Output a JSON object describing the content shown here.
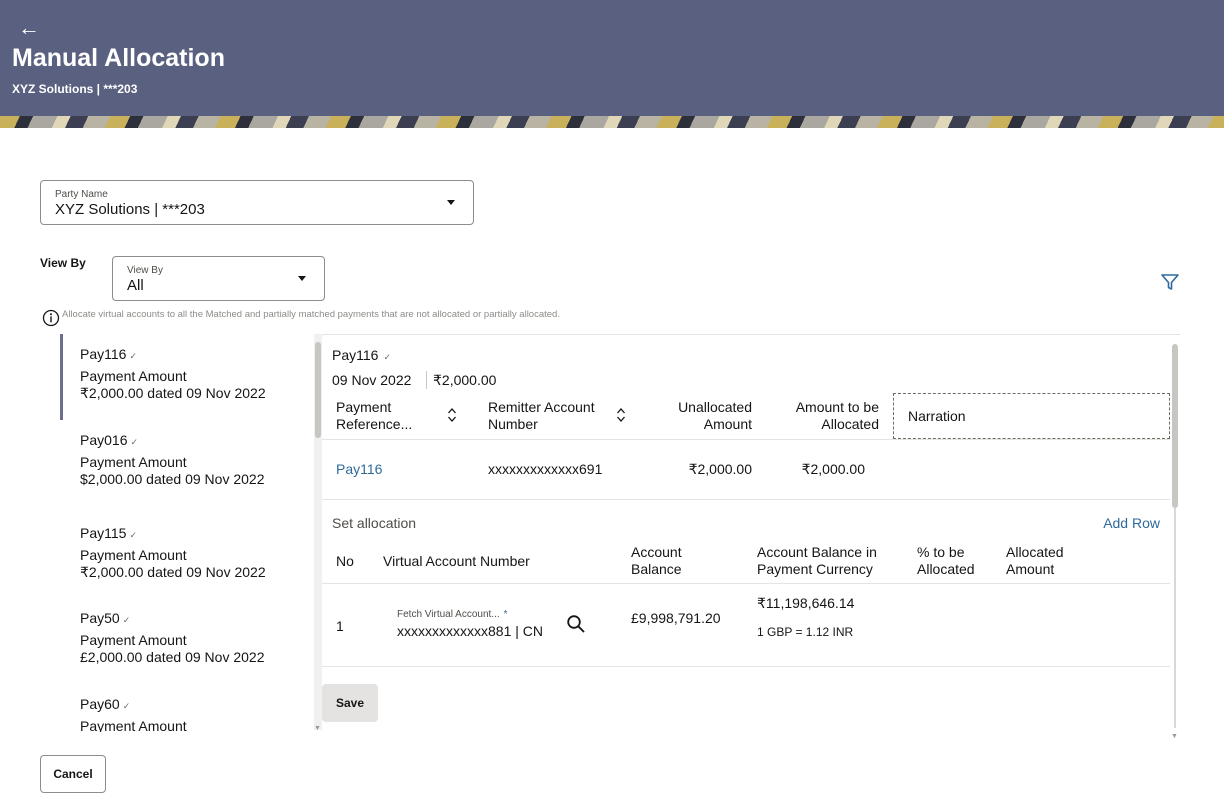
{
  "header": {
    "back_icon": "arrow-left-icon",
    "title": "Manual Allocation",
    "subtitle": "XYZ Solutions | ***203",
    "background_color": "#5a6080"
  },
  "party": {
    "label": "Party Name",
    "value": "XYZ Solutions | ***203"
  },
  "view_by": {
    "label": "View By",
    "field_label": "View By",
    "value": "All"
  },
  "info_text": "Allocate virtual accounts to all the Matched and partially matched payments that are not allocated or partially allocated.",
  "payments": [
    {
      "name": "Pay116",
      "amount_label": "Payment Amount",
      "amount": "₹2,000.00 dated 09 Nov 2022"
    },
    {
      "name": "Pay016",
      "amount_label": "Payment Amount",
      "amount": "$2,000.00 dated 09 Nov 2022"
    },
    {
      "name": "Pay115",
      "amount_label": "Payment Amount",
      "amount": "₹2,000.00 dated 09 Nov 2022"
    },
    {
      "name": "Pay50",
      "amount_label": "Payment Amount",
      "amount": "£2,000.00 dated 09 Nov 2022"
    },
    {
      "name": "Pay60",
      "amount_label": "Payment Amount",
      "amount": ""
    }
  ],
  "selected": {
    "name": "Pay116",
    "date": "09 Nov 2022",
    "total": "₹2,000.00"
  },
  "payment_table": {
    "headers": {
      "payment_reference_1": "Payment",
      "payment_reference_2": "Reference...",
      "remitter_1": "Remitter Account",
      "remitter_2": "Number",
      "unallocated_1": "Unallocated",
      "unallocated_2": "Amount",
      "to_allocate_1": "Amount to be",
      "to_allocate_2": "Allocated",
      "narration": "Narration"
    },
    "row": {
      "reference": "Pay116",
      "remitter": "xxxxxxxxxxxxx691",
      "unallocated": "₹2,000.00",
      "to_allocate": "₹2,000.00"
    }
  },
  "allocation": {
    "title": "Set allocation",
    "add_row": "Add Row",
    "headers": {
      "no": "No",
      "virtual_account": "Virtual Account Number",
      "balance_1": "Account",
      "balance_2": "Balance",
      "balance_pc_1": "Account Balance in",
      "balance_pc_2": "Payment Currency",
      "pct_1": "% to be",
      "pct_2": "Allocated",
      "allocated_1": "Allocated",
      "allocated_2": "Amount"
    },
    "row": {
      "no": "1",
      "va_label": "Fetch Virtual Account...",
      "va_required": "*",
      "va_value": "xxxxxxxxxxxxx881 | CN",
      "balance": "£9,998,791.20",
      "balance_pc": "₹11,198,646.14",
      "rate": "1 GBP = 1.12 INR"
    },
    "save": "Save"
  },
  "cancel": "Cancel"
}
